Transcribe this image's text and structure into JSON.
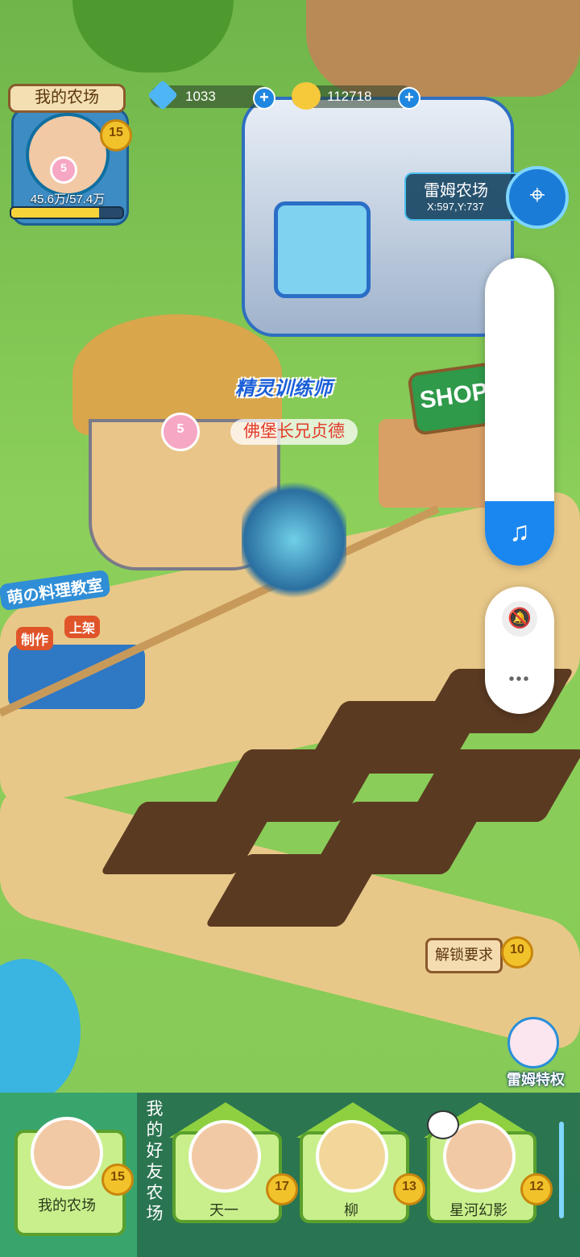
{
  "profile": {
    "tag": "我的农场",
    "level": "15",
    "pet_level": "5",
    "exp_text": "45.6万/57.4万",
    "exp_fraction": 0.79
  },
  "currency": {
    "diamonds": "1033",
    "coins": "112718"
  },
  "location": {
    "name": "雷姆农场",
    "coords": "X:597,Y:737"
  },
  "scene": {
    "player_title": "精灵训练师",
    "player_name": "佛堡长兄贞德",
    "player_pet_level": "5",
    "shop_sign": "SHOP",
    "cooking_title": "萌の料理教室",
    "cooking_make": "制作",
    "cooking_up": "上架",
    "unlock_label": "解锁要求",
    "unlock_level": "10",
    "vip_label": "雷姆特权"
  },
  "system_panel": {
    "volume_fraction": 0.21,
    "volume_icon": "music-note-icon",
    "mute_icon": "bell-off-icon",
    "more_label": "•••"
  },
  "bottom_bar": {
    "my_farm": {
      "label": "我的农场",
      "level": "15"
    },
    "friends_heading": [
      "我",
      "的",
      "好",
      "友",
      "农",
      "场"
    ],
    "friends": [
      {
        "name": "天一",
        "level": "17"
      },
      {
        "name": "柳",
        "level": "13"
      },
      {
        "name": "星河幻影",
        "level": "12"
      }
    ]
  },
  "colors": {
    "accent_blue": "#1a86f0",
    "grass": "#8ccf5a",
    "bar_green": "#38a56d"
  }
}
